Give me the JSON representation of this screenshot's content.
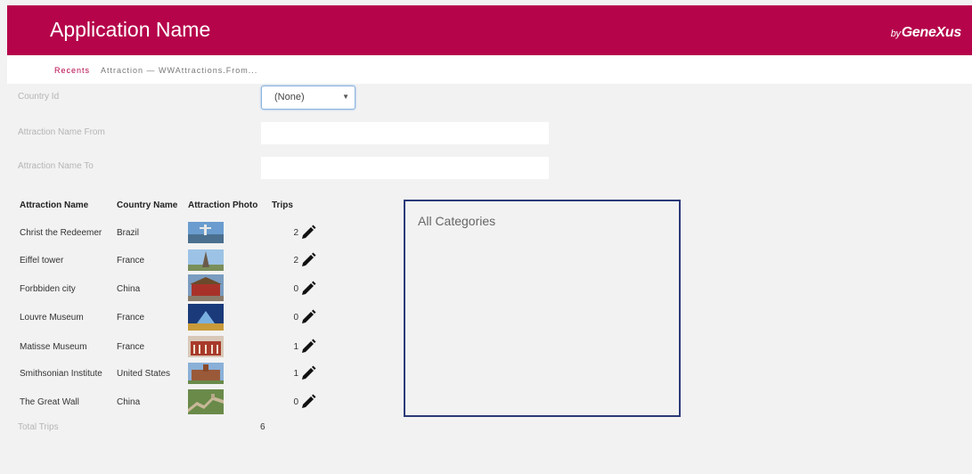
{
  "header": {
    "app_name": "Application Name",
    "brand_by": "by",
    "brand_name": "GeneXus",
    "background_color": "#b5044a"
  },
  "breadcrumb": {
    "recents": "Recents",
    "path": "Attraction — WWAttractions.From..."
  },
  "filters": {
    "country_id_label": "Country Id",
    "country_id_value": "(None)",
    "name_from_label": "Attraction Name From",
    "name_from_value": "",
    "name_to_label": "Attraction Name To",
    "name_to_value": ""
  },
  "grid": {
    "columns": [
      "Attraction Name",
      "Country Name",
      "Attraction Photo",
      "Trips"
    ],
    "rows": [
      {
        "name": "Christ the Redeemer",
        "country": "Brazil",
        "trips": "2",
        "photo_icon": "christ-redeemer-photo"
      },
      {
        "name": "Eiffel tower",
        "country": "France",
        "trips": "2",
        "photo_icon": "eiffel-tower-photo"
      },
      {
        "name": "Forbbiden city",
        "country": "China",
        "trips": "0",
        "photo_icon": "forbidden-city-photo"
      },
      {
        "name": "Louvre Museum",
        "country": "France",
        "trips": "0",
        "photo_icon": "louvre-museum-photo"
      },
      {
        "name": "Matisse Museum",
        "country": "France",
        "trips": "1",
        "photo_icon": "matisse-museum-photo"
      },
      {
        "name": "Smithsonian Institute",
        "country": "United States",
        "trips": "1",
        "photo_icon": "smithsonian-photo"
      },
      {
        "name": "The Great Wall",
        "country": "China",
        "trips": "0",
        "photo_icon": "great-wall-photo"
      }
    ]
  },
  "totals": {
    "label": "Total Trips",
    "value": "6"
  },
  "categories": {
    "title": "All Categories"
  }
}
